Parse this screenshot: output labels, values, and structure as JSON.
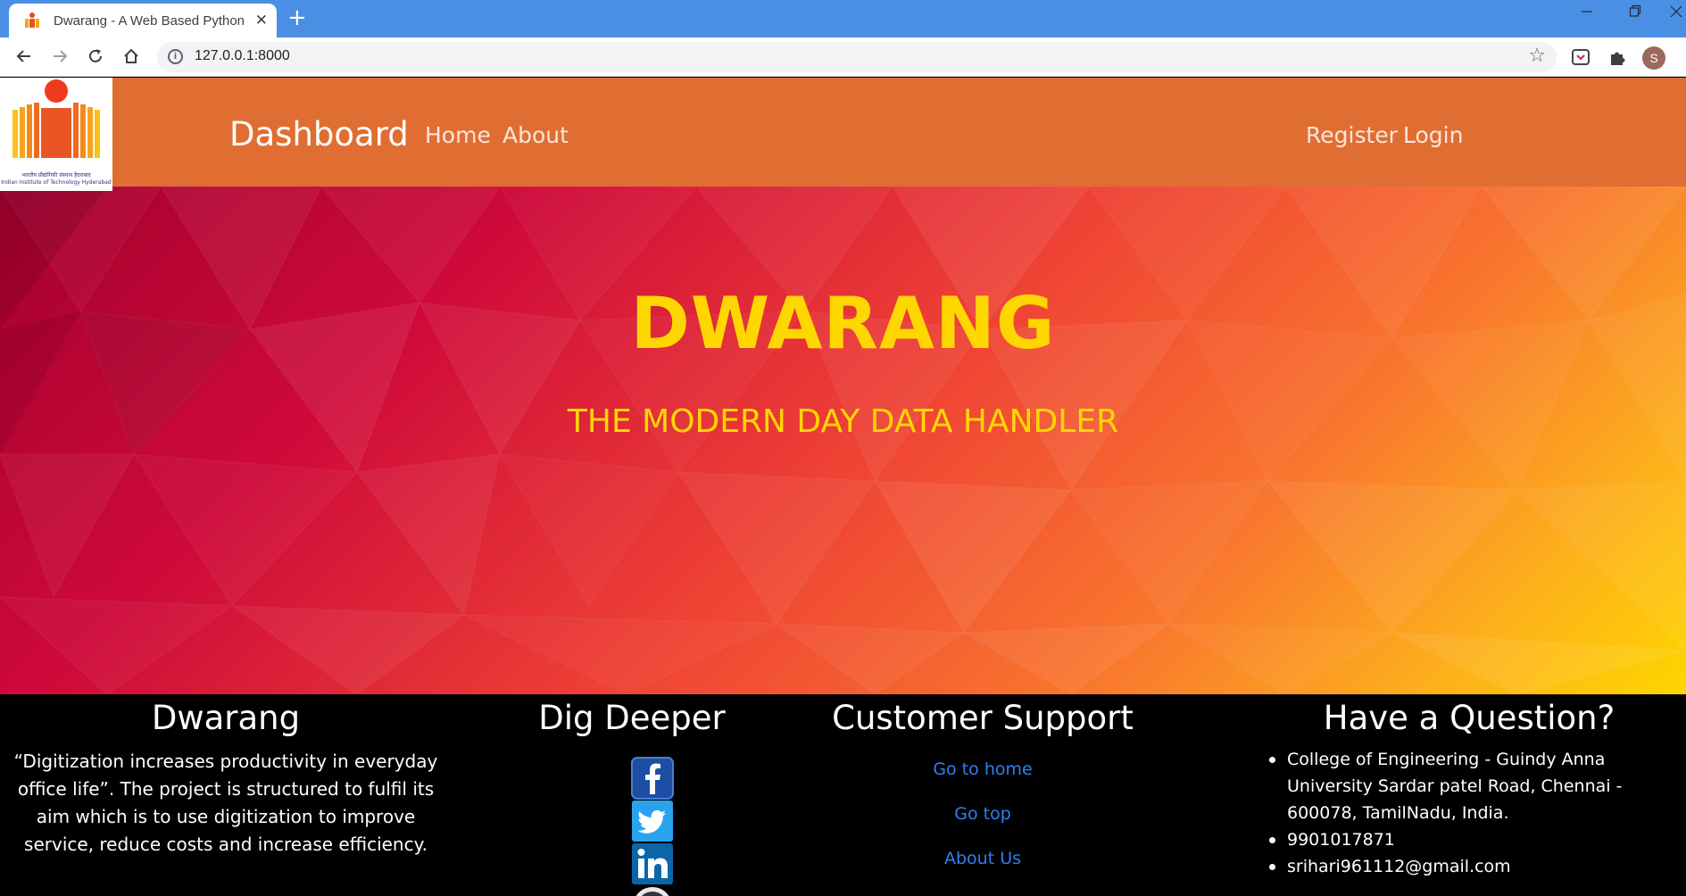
{
  "browser": {
    "tab_title": "Dwarang - A Web Based Python",
    "tab_close": "✕",
    "new_tab": "+",
    "url": "127.0.0.1:8000",
    "avatar_initial": "S",
    "nav_icons": [
      "back-arrow-icon",
      "forward-arrow-icon",
      "reload-icon",
      "home-icon"
    ],
    "window_controls": [
      "minimize",
      "restore",
      "close"
    ]
  },
  "navbar": {
    "logo_caption_line1": "भारतीय प्रौद्योगिकी संस्थान हैदराबाद",
    "logo_caption_line2": "Indian Institute of Technology Hyderabad",
    "brand": "Dashboard",
    "links": {
      "home": "Home",
      "about": "About",
      "register": "Register",
      "login": "Login"
    },
    "color": "#e06e33"
  },
  "hero": {
    "title": "DWARANG",
    "subtitle": "THE MODERN DAY DATA HANDLER",
    "text_color": "#ffd700"
  },
  "footer": {
    "about": {
      "heading": "Dwarang",
      "text": "“Digitization increases productivity in everyday office life”. The project is structured to fulfil its aim which is to use digitization to improve service, reduce costs and increase efficiency."
    },
    "dig_deeper": {
      "heading": "Dig Deeper",
      "icons": [
        "facebook-icon",
        "twitter-icon",
        "linkedin-icon",
        "github-icon"
      ]
    },
    "support": {
      "heading": "Customer Support",
      "links": [
        "Go to home",
        "Go top",
        "About Us"
      ]
    },
    "question": {
      "heading": "Have a Question?",
      "address": "College of Engineering - Guindy Anna University Sardar patel Road, Chennai - 600078, TamilNadu, India.",
      "phone": "9901017871",
      "email": "srihari961112@gmail.com"
    },
    "link_color": "#2f7ff0"
  }
}
